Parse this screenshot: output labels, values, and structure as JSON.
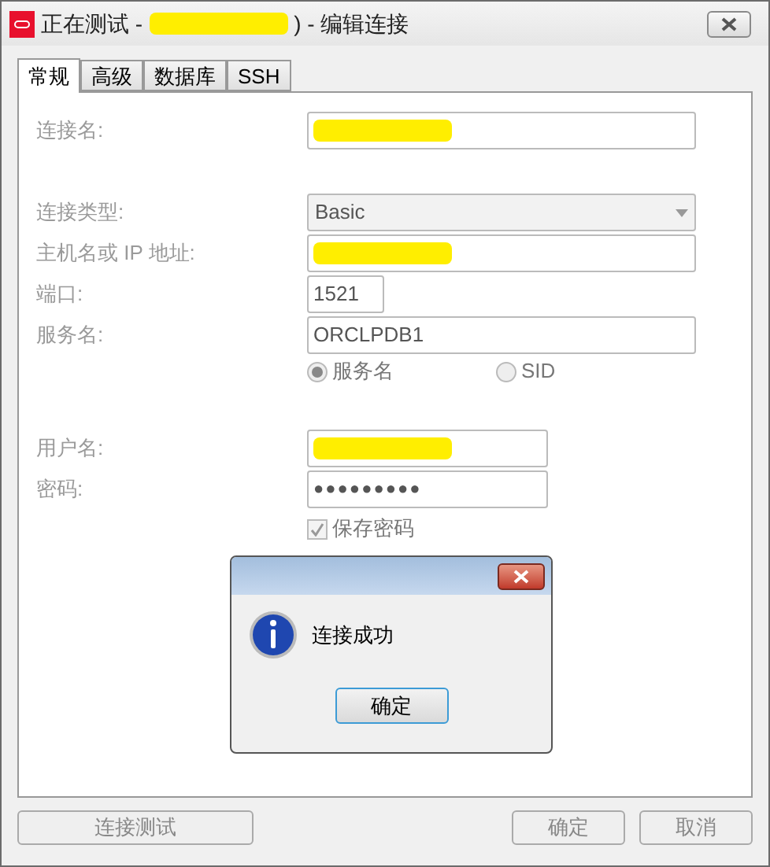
{
  "window": {
    "title_prefix": "正在测试 -",
    "title_suffix": ") - 编辑连接",
    "title_redacted": true
  },
  "tabs": [
    {
      "label": "常规",
      "selected": true
    },
    {
      "label": "高级",
      "selected": false
    },
    {
      "label": "数据库",
      "selected": false
    },
    {
      "label": "SSH",
      "selected": false
    }
  ],
  "form": {
    "sections": [
      {
        "fields": [
          {
            "kind": "text",
            "label": "连接名:",
            "redacted": true
          }
        ]
      },
      {
        "fields": [
          {
            "kind": "select",
            "label": "连接类型:",
            "value": "Basic"
          },
          {
            "kind": "text",
            "label": "主机名或 IP 地址:",
            "redacted": true
          },
          {
            "kind": "text",
            "label": "端口:",
            "value": "1521"
          },
          {
            "kind": "text",
            "label": "服务名:",
            "value": "ORCLPDB1"
          },
          {
            "kind": "radios",
            "options": [
              {
                "label": "服务名",
                "selected": true
              },
              {
                "label": "SID",
                "selected": false
              }
            ]
          }
        ]
      },
      {
        "fields": [
          {
            "kind": "text",
            "label": "用户名:",
            "redacted": true
          },
          {
            "kind": "password",
            "label": "密码:",
            "value": "●●●●●●●●●"
          },
          {
            "kind": "checkbox",
            "label": "保存密码",
            "checked": true
          }
        ]
      }
    ]
  },
  "buttons": {
    "test": "连接测试",
    "ok": "确定",
    "cancel": "取消"
  },
  "message_box": {
    "message": "连接成功",
    "ok": "确定"
  }
}
